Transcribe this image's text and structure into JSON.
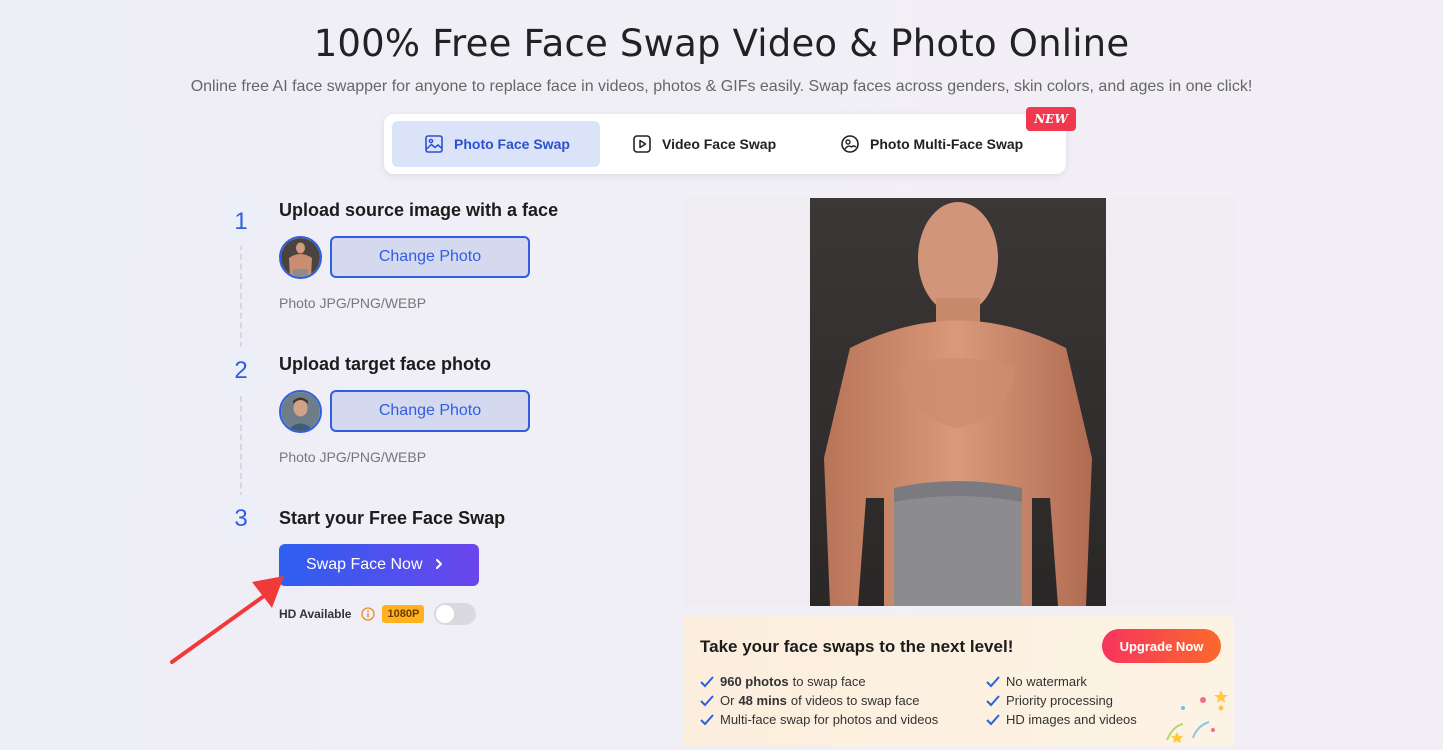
{
  "header": {
    "title": "100% Free Face Swap Video & Photo Online",
    "subtitle": "Online free AI face swapper for anyone to replace face in videos, photos & GIFs easily. Swap faces across genders, skin colors, and ages in one click!"
  },
  "tabs": [
    {
      "label": "Photo Face Swap",
      "active": true,
      "icon": "image-icon"
    },
    {
      "label": "Video Face Swap",
      "active": false,
      "icon": "play-icon"
    },
    {
      "label": "Photo Multi-Face Swap",
      "active": false,
      "icon": "faces-icon"
    }
  ],
  "new_badge": "NEW",
  "steps": [
    {
      "number": "1",
      "title": "Upload source image with a face",
      "button": "Change Photo",
      "hint": "Photo JPG/PNG/WEBP"
    },
    {
      "number": "2",
      "title": "Upload target face photo",
      "button": "Change Photo",
      "hint": "Photo JPG/PNG/WEBP"
    },
    {
      "number": "3",
      "title": "Start your Free Face Swap"
    }
  ],
  "swap_button": "Swap Face Now",
  "hd": {
    "label": "HD Available",
    "badge": "1080P",
    "enabled": false
  },
  "promo": {
    "title": "Take your face swaps to the next level!",
    "upgrade_button": "Upgrade Now",
    "features_left": [
      {
        "bold": "960 photos",
        "text": "to swap face"
      },
      {
        "pre": "Or",
        "bold": "48 mins",
        "text": "of videos to swap face"
      },
      {
        "text": "Multi-face swap for photos and videos"
      }
    ],
    "features_right": [
      {
        "text": "No watermark"
      },
      {
        "text": "Priority processing"
      },
      {
        "text": "HD images and videos"
      }
    ]
  },
  "colors": {
    "accent": "#2f5fe0",
    "badge_red": "#f0384f",
    "upgrade_gradient_start": "#f7345d",
    "upgrade_gradient_end": "#fa6a2c",
    "hd_badge": "#ffb21e"
  }
}
